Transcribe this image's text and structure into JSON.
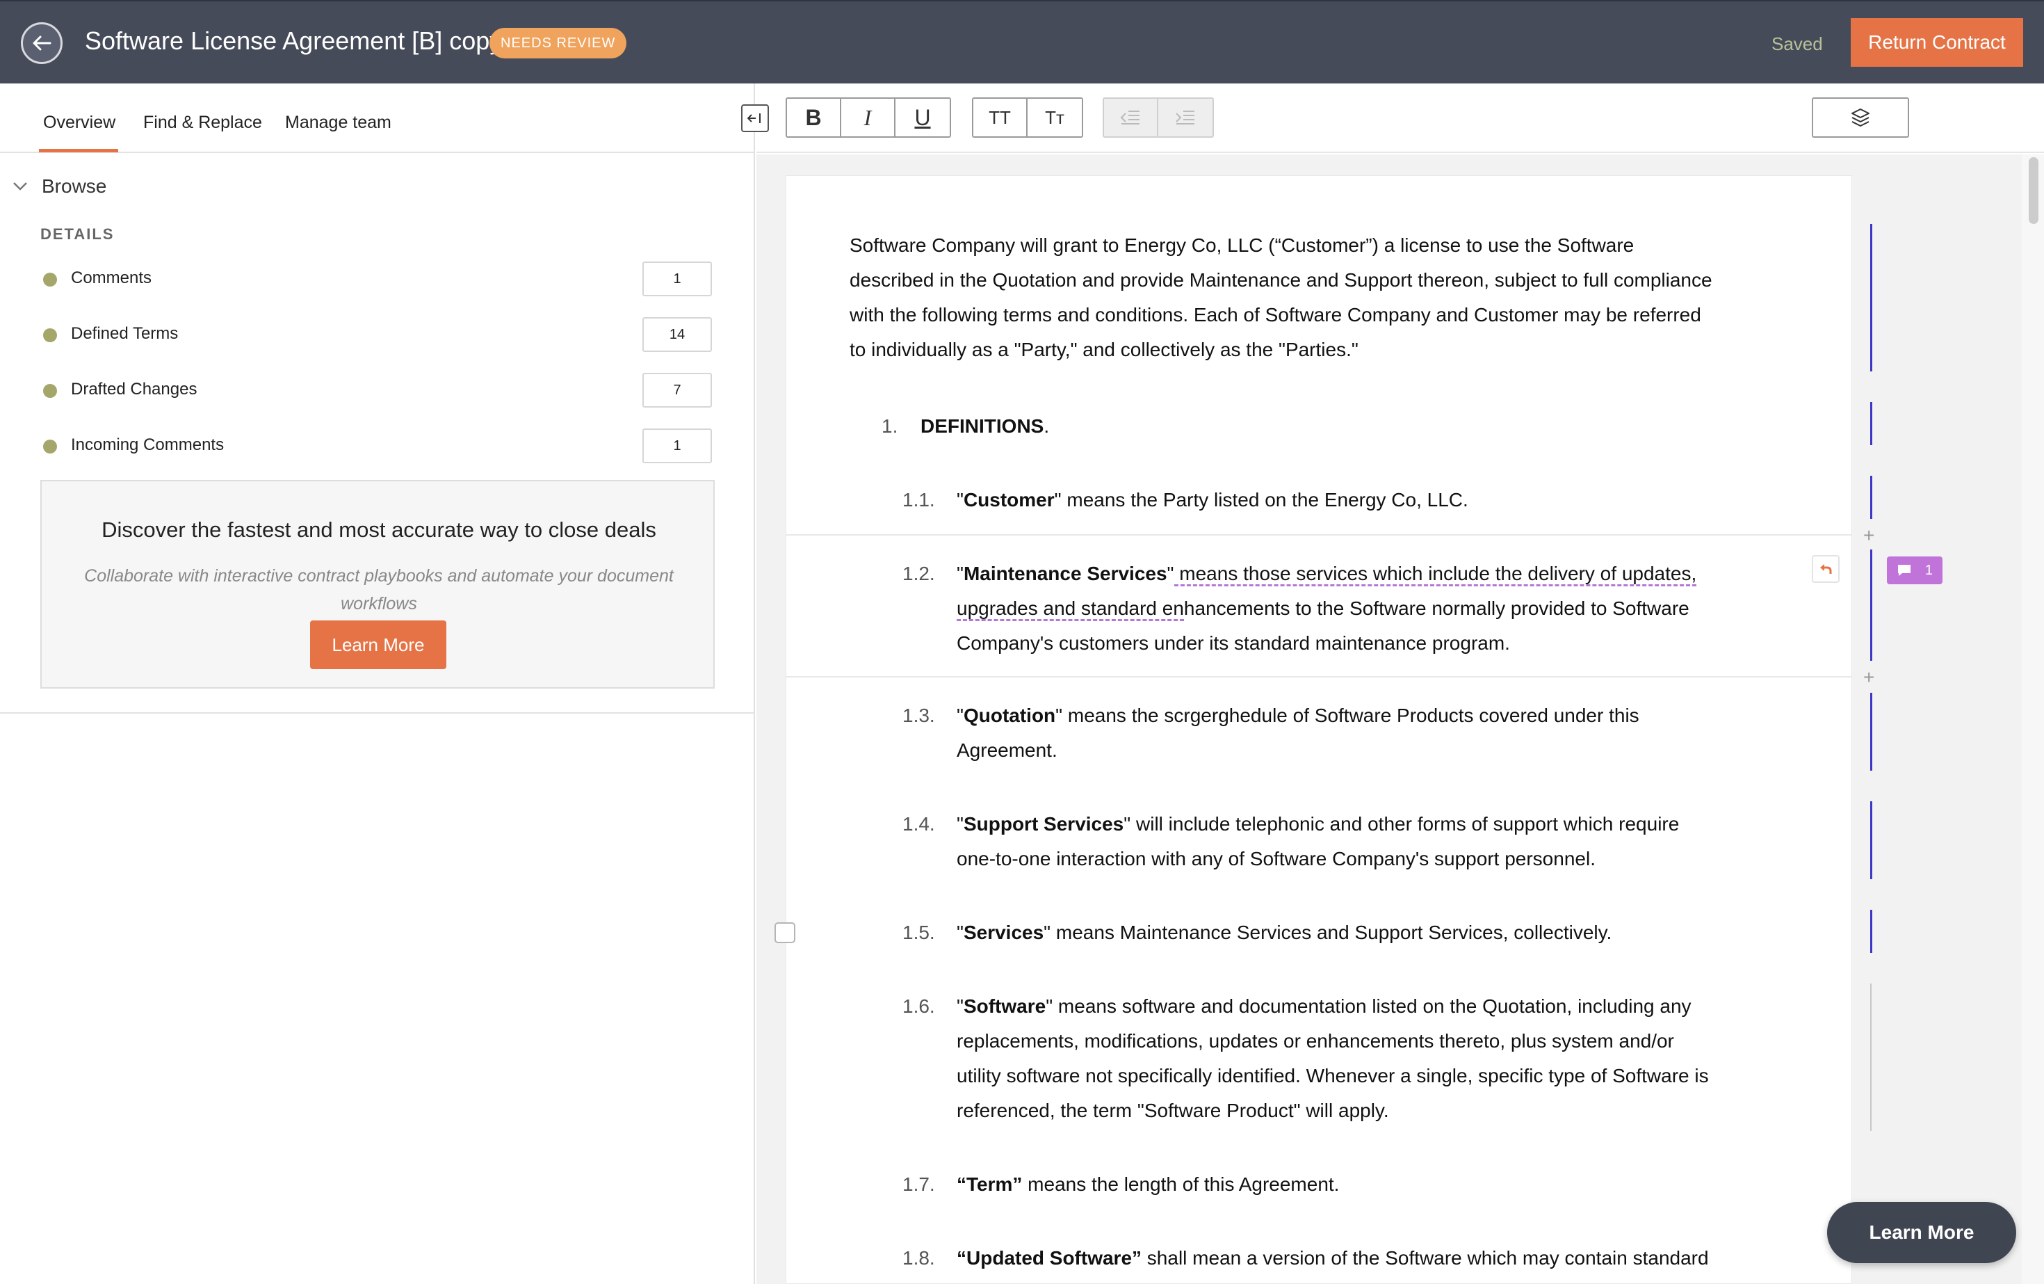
{
  "header": {
    "title": "Software License Agreement [B] copy",
    "status_badge": "NEEDS REVIEW",
    "saved_label": "Saved",
    "return_button": "Return Contract"
  },
  "left_panel": {
    "tabs": [
      "Overview",
      "Find & Replace",
      "Manage team"
    ],
    "active_tab": "Overview",
    "browse_label": "Browse",
    "details_label": "DETAILS",
    "details": [
      {
        "label": "Comments",
        "count": "1"
      },
      {
        "label": "Defined Terms",
        "count": "14"
      },
      {
        "label": "Drafted Changes",
        "count": "7"
      },
      {
        "label": "Incoming Comments",
        "count": "1"
      }
    ],
    "promo": {
      "title": "Discover the fastest and most accurate way to close deals",
      "subtitle": "Collaborate with interactive contract playbooks and automate your document workflows",
      "button": "Learn More"
    }
  },
  "toolbar": {
    "bold": "B",
    "italic": "I",
    "underline": "U",
    "uppercase": "TT",
    "smallcaps": "Tт"
  },
  "document": {
    "intro": "Software Company will grant to Energy Co, LLC (“Customer”) a license to use the Software described in the Quotation and provide Maintenance and Support thereon, subject to full compliance with the following terms and conditions.  Each of Software Company and Customer may be referred to individually as a \"Party,\" and collectively as the \"Parties.\"",
    "section": {
      "number": "1.",
      "title": "DEFINITIONS",
      "suffix": "."
    },
    "clauses": [
      {
        "number": "1.1.",
        "term": "Customer",
        "open": "\"",
        "close": "\"",
        "text": " means the Party listed on the Energy Co, LLC."
      },
      {
        "number": "1.2.",
        "term": "Maintenance Services",
        "open": "\"",
        "close": "\"",
        "highlighted": " means those services which include the delivery of updates, upgrades and standard en",
        "text": "hancements to the Software normally provided to Software Company's customers under its standard maintenance program."
      },
      {
        "number": "1.3.",
        "term": "Quotation",
        "open": "\"",
        "close": "\"",
        "text": " means the scrgerghedule of Software Products covered under this Agreement."
      },
      {
        "number": "1.4.",
        "term": "Support Services",
        "open": "\"",
        "close": "\"",
        "text": " will include telephonic and other forms of support which require one-to-one interaction with any of Software Company's support personnel."
      },
      {
        "number": "1.5.",
        "term": "Services",
        "open": "\"",
        "close": "\"",
        "text": " means Maintenance Services and Support Services, collectively."
      },
      {
        "number": "1.6.",
        "term": "Software",
        "open": "\"",
        "close": "\"",
        "text": " means software and documentation listed on the Quotation, including any replacements, modifications, updates or enhancements thereto, plus system and/or utility software not specifically identified.  Whenever a single, specific type of Software is referenced, the term \"Software Product\" will apply."
      },
      {
        "number": "1.7.",
        "term": "Term",
        "open": "“",
        "close": "”",
        "text": " means the length of this Agreement."
      },
      {
        "number": "1.8.",
        "term": "Updated Software",
        "open": "“",
        "close": "”",
        "text": " shall mean a version of the Software which may contain standard"
      }
    ]
  },
  "comment_badge_count": "1",
  "floating_button": "Learn More",
  "colors": {
    "header_bg": "#454b59",
    "accent": "#e57346",
    "badge": "#f0a35d",
    "gutter": "#3d36c8",
    "comment": "#c073d9"
  }
}
